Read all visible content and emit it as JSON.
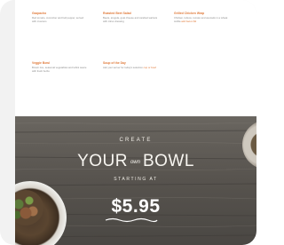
{
  "menu": {
    "items": [
      {
        "name": "Gazpacho",
        "desc": "Red tomato, cucumber and bell pepper, served with croutons"
      },
      {
        "name": "Roasted Beet Salad",
        "desc": "Beets, arugula, goat cheese and candied walnuts with citrus dressing"
      },
      {
        "name": "Grilled Chicken Wrap",
        "desc": "Chicken, lettuce, tomato and avocado in a wheat tortilla",
        "highlight": "add bacon $2"
      },
      {
        "name": "Veggie Bowl",
        "desc": "Brown rice, seasonal vegetables and tahini sauce with fresh herbs"
      },
      {
        "name": "Soup of the Day",
        "desc": "Ask your server for today's selection",
        "highlight": "cup or bowl"
      }
    ]
  },
  "hero": {
    "create": "CREATE",
    "your": "YOUR",
    "own": "own",
    "bowl": "BOWL",
    "starting_at": "STARTING AT",
    "price": "$5.95"
  },
  "colors": {
    "accent": "#e07a3a",
    "wood": "#5e5a55",
    "text_light": "#ffffff"
  }
}
